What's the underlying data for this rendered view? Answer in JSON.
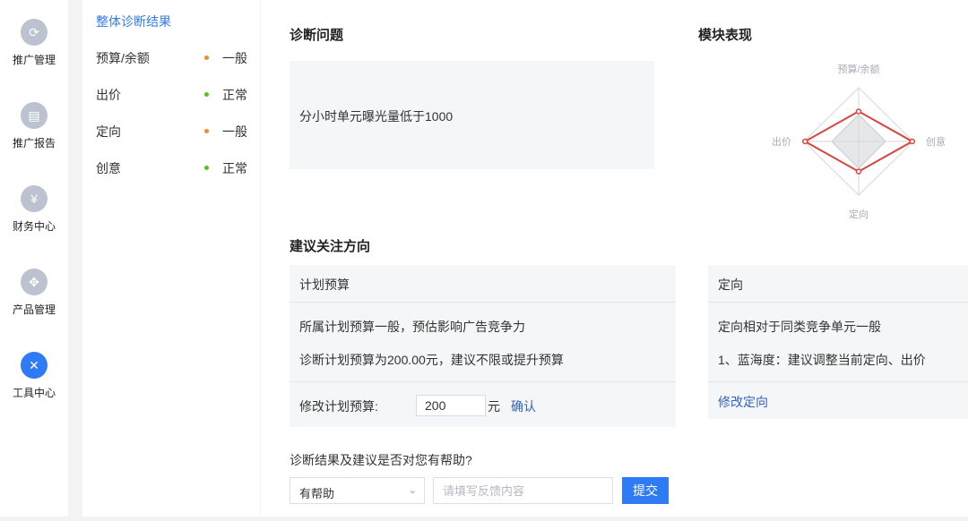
{
  "rail": [
    {
      "label": "推广管理",
      "icon": "refresh-icon",
      "glyph": "⟳",
      "active": false
    },
    {
      "label": "推广报告",
      "icon": "report-icon",
      "glyph": "▤",
      "active": false
    },
    {
      "label": "财务中心",
      "icon": "yen-icon",
      "glyph": "¥",
      "active": false
    },
    {
      "label": "产品管理",
      "icon": "grid-icon",
      "glyph": "✥",
      "active": false
    },
    {
      "label": "工具中心",
      "icon": "tools-icon",
      "glyph": "✕",
      "active": true
    }
  ],
  "submenu": {
    "title": "整体诊断结果",
    "items": [
      {
        "label": "预算/余额",
        "status": "一般",
        "dot_color": "#f28b2c"
      },
      {
        "label": "出价",
        "status": "正常",
        "dot_color": "#52c41a"
      },
      {
        "label": "定向",
        "status": "一般",
        "dot_color": "#f28b2c"
      },
      {
        "label": "创意",
        "status": "正常",
        "dot_color": "#52c41a"
      }
    ]
  },
  "diagnosis": {
    "title": "诊断问题",
    "issue": "分小时单元曝光量低于1000"
  },
  "module": {
    "title": "模块表现",
    "axes": [
      "预算/余额",
      "创意",
      "定向",
      "出价"
    ],
    "values": [
      0.55,
      0.98,
      0.55,
      0.98
    ],
    "line_color": "#d9453d"
  },
  "suggest": {
    "title": "建议关注方向",
    "budget_card": {
      "head": "计划预算",
      "line1": "所属计划预算一般，预估影响广告竞争力",
      "line2": "诊断计划预算为200.00元，建议不限或提升预算",
      "edit_label": "修改计划预算:",
      "input_value": "200",
      "unit": "元",
      "confirm": "确认"
    },
    "target_card": {
      "head": "定向",
      "line1": "定向相对于同类竞争单元一般",
      "line2": "1、蓝海度：建议调整当前定向、出价",
      "link": "修改定向"
    }
  },
  "feedback": {
    "question": "诊断结果及建议是否对您有帮助?",
    "select_value": "有帮助",
    "placeholder": "请填写反馈内容",
    "submit": "提交"
  }
}
